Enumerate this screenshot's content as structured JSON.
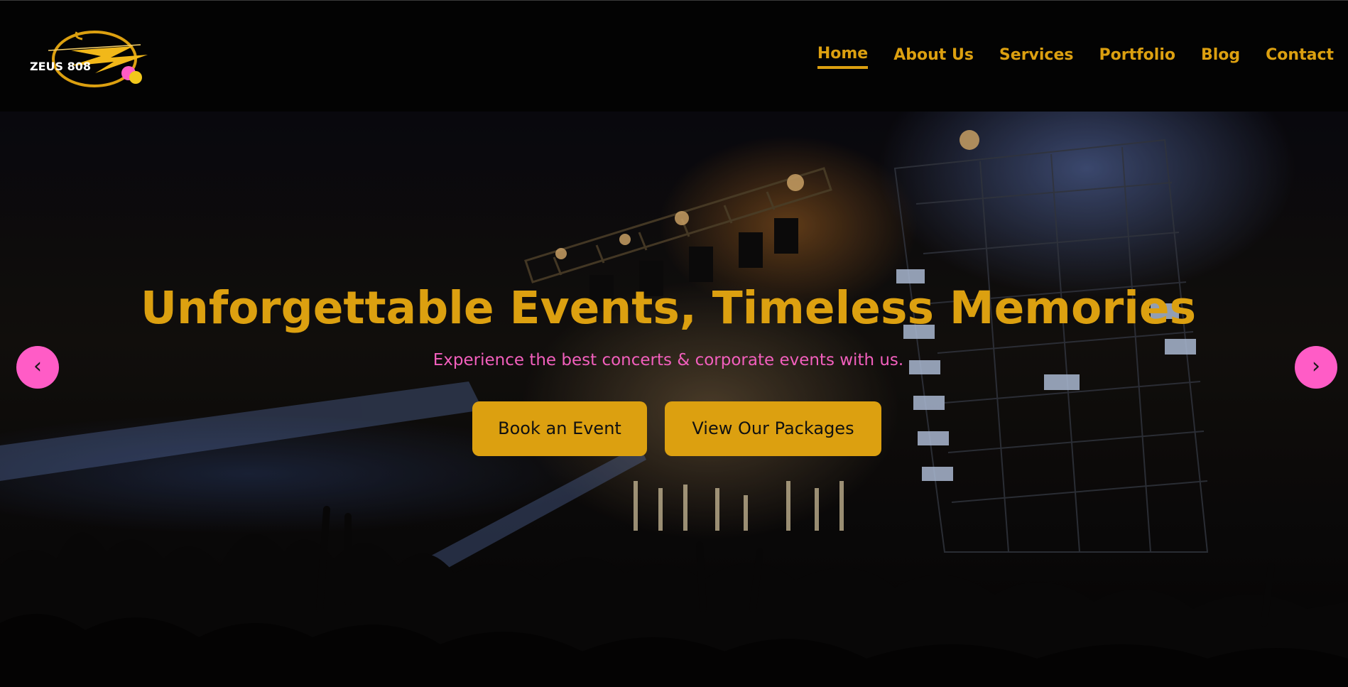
{
  "brand": {
    "logo_text": "ZEUS 808",
    "logo_icon": "lightning-bolt-ring-icon"
  },
  "nav": {
    "items": [
      {
        "label": "Home",
        "active": true
      },
      {
        "label": "About Us",
        "active": false
      },
      {
        "label": "Services",
        "active": false
      },
      {
        "label": "Portfolio",
        "active": false
      },
      {
        "label": "Blog",
        "active": false
      },
      {
        "label": "Contact",
        "active": false
      }
    ]
  },
  "hero": {
    "title": "Unforgettable Events, Timeless Memories",
    "subtitle": "Experience the best concerts & corporate events with us.",
    "buttons": {
      "book": "Book an Event",
      "packages": "View Our Packages"
    },
    "prev_icon": "‹",
    "next_icon": "›",
    "background_image": "concert stage crowd"
  },
  "colors": {
    "accent_gold": "#dca010",
    "accent_pink": "#ff5cc6",
    "header_bg": "#030303"
  }
}
